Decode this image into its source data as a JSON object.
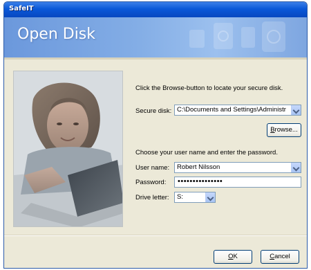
{
  "window": {
    "title": "SafeIT"
  },
  "header": {
    "title": "Open Disk"
  },
  "form": {
    "instruction": "Click the Browse-button to locate your secure disk.",
    "secure_disk_label": "Secure disk:",
    "secure_disk_value": "C:\\Documents and Settings\\Administr",
    "browse_label": "Browse...",
    "credentials_instruction": "Choose your user name and enter the password.",
    "username_label": "User name:",
    "username_value": "Robert Nilsson",
    "password_label": "Password:",
    "password_value": "•••••••••••••••",
    "drive_label": "Drive letter:",
    "drive_value": "S:"
  },
  "buttons": {
    "ok_label": "OK",
    "cancel_label": "Cancel"
  },
  "colors": {
    "header_blue": "#84aee6",
    "titlebar_blue": "#0a58d8",
    "dialog_bg": "#ece9d8"
  }
}
